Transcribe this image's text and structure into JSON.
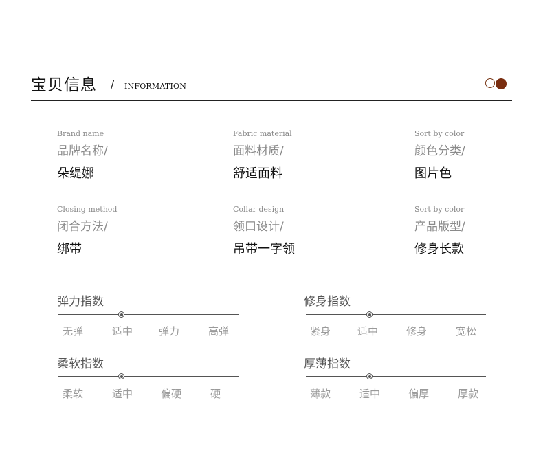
{
  "header": {
    "title": "宝贝信息",
    "slash": "/",
    "subtitle": "INFORMATION"
  },
  "specs": [
    {
      "en": "Brand name",
      "label": "品牌名称/",
      "value": "朵缇娜"
    },
    {
      "en": "Fabric material",
      "label": "面料材质/",
      "value": "舒适面料"
    },
    {
      "en": "Sort by color",
      "label": "颜色分类/",
      "value": "图片色"
    },
    {
      "en": "Closing method",
      "label": "闭合方法/",
      "value": "绑带"
    },
    {
      "en": "Collar design",
      "label": "领口设计/",
      "value": "吊带一字领"
    },
    {
      "en": "Sort by color",
      "label": "产品版型/",
      "value": "修身长款"
    }
  ],
  "indices": [
    {
      "title": "弹力指数",
      "labels": [
        "无弹",
        "适中",
        "弹力",
        "高弹"
      ],
      "selected": 1
    },
    {
      "title": "修身指数",
      "labels": [
        "紧身",
        "适中",
        "修身",
        "宽松"
      ],
      "selected": 1
    },
    {
      "title": "柔软指数",
      "labels": [
        "柔软",
        "适中",
        "偏硬",
        "硬"
      ],
      "selected": 1
    },
    {
      "title": "厚薄指数",
      "labels": [
        "薄款",
        "适中",
        "偏厚",
        "厚款"
      ],
      "selected": 1
    }
  ],
  "colors": {
    "accent": "#7a2e10"
  }
}
